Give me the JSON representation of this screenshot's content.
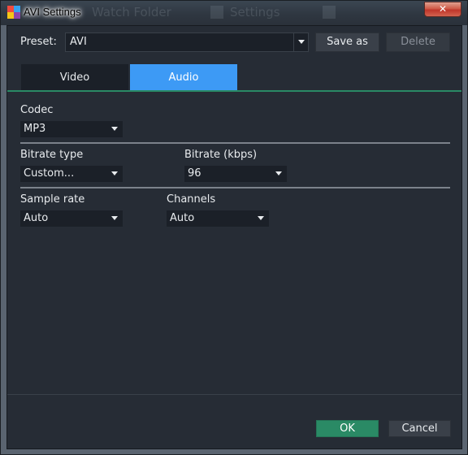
{
  "window": {
    "title": "AVI Settings",
    "close_glyph": "✕",
    "background_ghost": {
      "batch_folder": "Watch Folder",
      "settings": "Settings"
    }
  },
  "preset": {
    "label": "Preset:",
    "value": "AVI",
    "save_as": "Save as",
    "delete": "Delete"
  },
  "tabs": [
    {
      "label": "Video",
      "active": false
    },
    {
      "label": "Audio",
      "active": true
    }
  ],
  "audio": {
    "codec": {
      "label": "Codec",
      "value": "MP3"
    },
    "bitrate_type": {
      "label": "Bitrate type",
      "value": "Custom..."
    },
    "bitrate": {
      "label": "Bitrate (kbps)",
      "value": "96"
    },
    "sample_rate": {
      "label": "Sample rate",
      "value": "Auto"
    },
    "channels": {
      "label": "Channels",
      "value": "Auto"
    }
  },
  "footer": {
    "ok": "OK",
    "cancel": "Cancel"
  },
  "colors": {
    "accent_green": "#2a8a65",
    "tab_active_blue": "#3d9af5",
    "background": "#262c35",
    "field_background": "#1b2028"
  },
  "icons": {
    "app": "movavi-app-icon",
    "close": "close-icon",
    "dropdown": "chevron-down-icon"
  }
}
